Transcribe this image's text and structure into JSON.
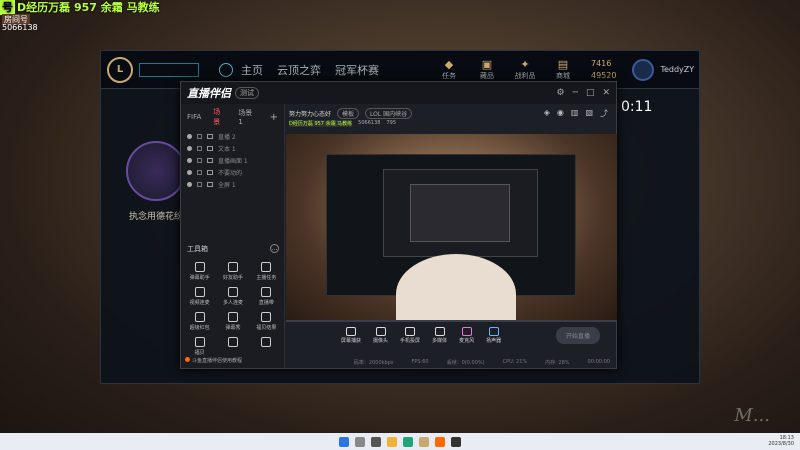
{
  "overlay": {
    "tag": "号",
    "title": "D经历万磊 957 余霜 马教练",
    "sub": "房间号",
    "room_id": "5066138"
  },
  "lol": {
    "logo": "L",
    "nav": [
      "主页",
      "云顶之弈",
      "冠军杯赛"
    ],
    "icons": [
      {
        "label": "任务"
      },
      {
        "label": "藏品"
      },
      {
        "label": "战利品"
      },
      {
        "label": "商城"
      }
    ],
    "currency_be": "7416",
    "currency_rp": "49520",
    "username": "TeddyZY",
    "summoner": "执念用德花纷",
    "clock": "0:11"
  },
  "app": {
    "logo": "直播伴侣",
    "version": "测试",
    "scene_tabs": [
      "FIFA",
      "场景",
      "场景 1"
    ],
    "scenes": [
      "直播 2",
      "文本 1",
      "直播画面 1",
      "不要动的",
      "全屏 1"
    ],
    "tools_title": "工具箱",
    "tools": [
      "弹幕助手",
      "好友助手",
      "主播任务",
      "视频连麦",
      "多人连麦",
      "直播带",
      "超级红包",
      "弹幕秀",
      "福贝结果",
      "福贝",
      "",
      ""
    ],
    "notice": "斗鱼直播伴侣使用教程",
    "room_title": "努力努力心态好",
    "room_pill1": "模板",
    "room_pill2": "LOL 国内峡谷",
    "room_stat": "D经历万磊 957 余霜 马教练",
    "room_id": "5066138",
    "room_fans": "795",
    "bottom_tools": [
      "屏幕捕获",
      "摄像头",
      "手机投屏",
      "多媒体",
      "麦克风",
      "扬声器"
    ],
    "go_live": "开始直播",
    "status": [
      "码率：2000kbps",
      "FPS:60",
      "丢帧：0(0.00%)",
      "CPU: 21%",
      "内存: 28%",
      "00:00:00"
    ]
  },
  "taskbar": {
    "time": "18:13",
    "date": "2023/8/30"
  },
  "watermark": "M..."
}
